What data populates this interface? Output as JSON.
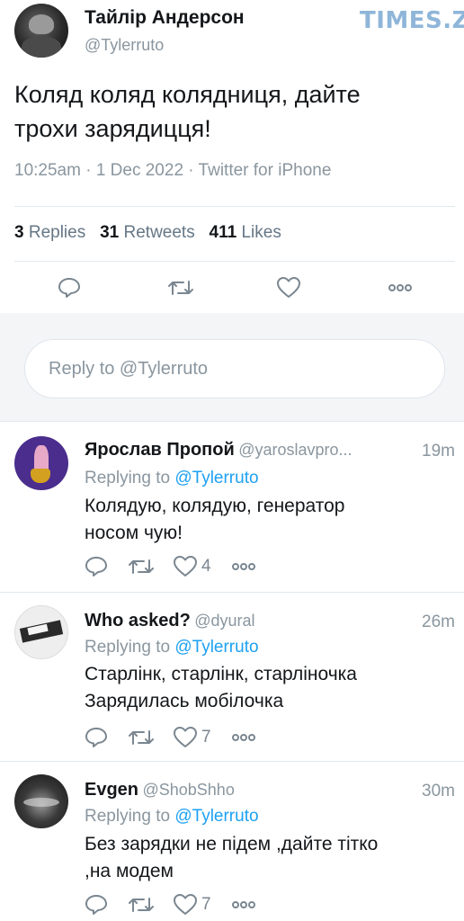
{
  "watermark": "TIMES.ZT",
  "main_tweet": {
    "display_name": "Тайлір Андерсон",
    "handle": "@Tylerruto",
    "text_line1": "Коляд коляд колядниця, дайте",
    "text_line2": "трохи зарядицця!",
    "meta": "10:25am · 1 Dec 2022 · Twitter for iPhone",
    "stats": {
      "replies_count": "3",
      "replies_label": "Replies",
      "retweets_count": "31",
      "retweets_label": "Retweets",
      "likes_count": "411",
      "likes_label": "Likes"
    },
    "actions": [
      "reply-icon",
      "retweet-icon",
      "like-icon",
      "more-icon"
    ]
  },
  "reply_box": {
    "placeholder": "Reply to @Tylerruto"
  },
  "replies": [
    {
      "display_name": "Ярослав Пропой",
      "handle": "@yaroslavpro...",
      "time": "19m",
      "replying_prefix": "Replying to",
      "replying_to": "@Tylerruto",
      "text_line1": "Колядую, колядую, генератор",
      "text_line2": "носом чую!",
      "like_count": "4"
    },
    {
      "display_name": "Who asked?",
      "handle": "@dyural",
      "time": "26m",
      "replying_prefix": "Replying to",
      "replying_to": "@Tylerruto",
      "text_line1": "Старлінк, старлінк, старліночка",
      "text_line2": "Зарядилась мобілочка",
      "like_count": "7"
    },
    {
      "display_name": "Evgen",
      "handle": "@ShobShho",
      "time": "30m",
      "replying_prefix": "Replying to",
      "replying_to": "@Tylerruto",
      "text_line1": "Без зарядки не підем ,дайте тітко",
      "text_line2": ",на модем",
      "like_count": "7"
    }
  ],
  "colors": {
    "link": "#1da1f2",
    "muted": "#8a969f",
    "divider": "#e1e8ed",
    "watermark": "#8fb6d9"
  }
}
